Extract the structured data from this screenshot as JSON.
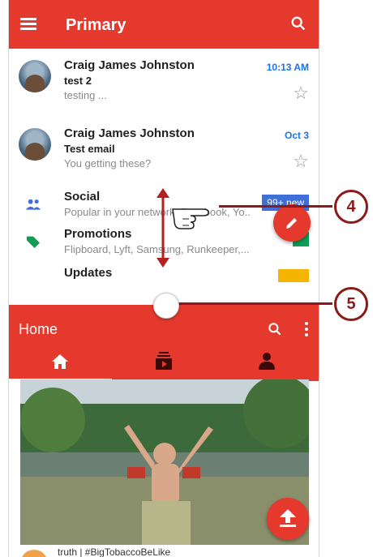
{
  "gmail": {
    "title": "Primary",
    "emails": [
      {
        "sender": "Craig James Johnston",
        "subject": "test 2",
        "snippet": "testing ...",
        "time": "10:13 AM"
      },
      {
        "sender": "Craig James Johnston",
        "subject": "Test email",
        "snippet": "You getting these?",
        "time": "Oct 3"
      }
    ],
    "categories": [
      {
        "name": "Social",
        "desc": "Popular in your network, Facebook, Yo...",
        "badge": "99+ new",
        "color": "#3f6fd8"
      },
      {
        "name": "Promotions",
        "desc": "Flipboard, Lyft, Samsung, Runkeeper,...",
        "badge": "",
        "color": "#0f9d58"
      },
      {
        "name": "Updates",
        "desc": "",
        "badge": "",
        "color": "#f4b400"
      }
    ]
  },
  "youtube": {
    "title": "Home",
    "next_item_title": "truth | #BigTobaccoBeLike"
  },
  "callouts": {
    "first": "4",
    "second": "5"
  },
  "colors": {
    "accent": "#e5392e",
    "callout": "#8b1a1a"
  }
}
